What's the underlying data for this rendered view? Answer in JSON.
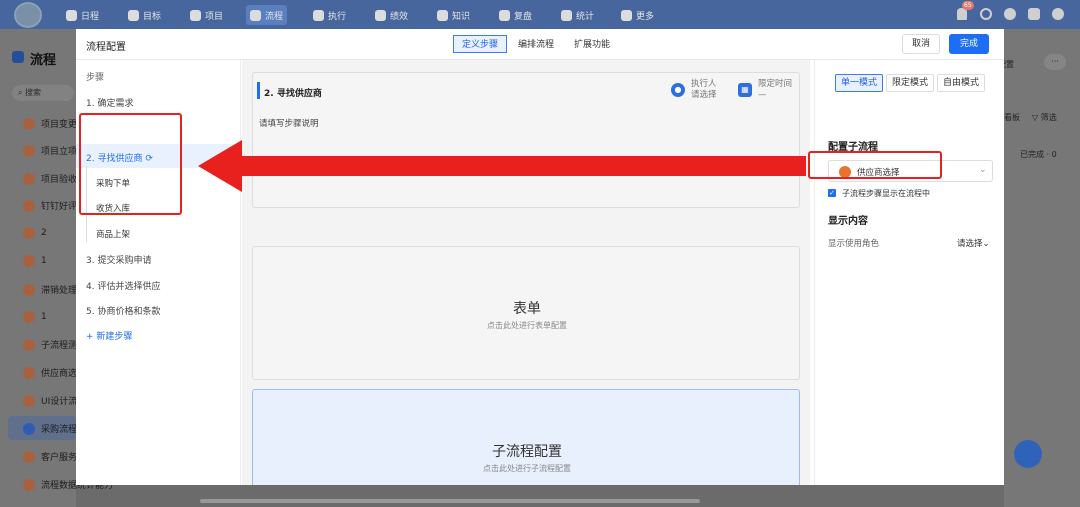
{
  "topnav": {
    "items": [
      "日程",
      "目标",
      "项目",
      "流程",
      "执行",
      "绩效",
      "知识",
      "复盘",
      "统计",
      "更多"
    ],
    "active": "流程",
    "badge": "65"
  },
  "bg": {
    "page_title": "流程",
    "search_placeholder": "搜索",
    "items": [
      "项目变更",
      "项目立项",
      "项目验收",
      "钉钉好评",
      "2",
      "1",
      "滞销处理",
      "1",
      "子流程测",
      "供应商选",
      "UI设计流",
      "采购流程",
      "客户服务",
      "流程数据统计能力"
    ],
    "right_config": "配置",
    "right_more": "···",
    "right_board": "看板",
    "right_filter": "筛选",
    "right_done": "已完成 · 0"
  },
  "modal": {
    "title": "流程配置",
    "tabs": [
      "定义步骤",
      "编排流程",
      "扩展功能"
    ],
    "active_tab": "定义步骤",
    "cancel": "取消",
    "done": "完成"
  },
  "steps": {
    "heading": "步骤",
    "items": [
      "1. 确定需求",
      "2. 寻找供应商",
      "3. 提交采购申请",
      "4. 评估并选择供应",
      "5. 协商价格和条款"
    ],
    "active_index": 1,
    "subs": [
      "采购下单",
      "收货入库",
      "商品上架"
    ],
    "new_step": "+ 新建步骤"
  },
  "main": {
    "step_title": "2. 寻找供应商",
    "step_desc": "请填写步骤说明",
    "executor_label": "执行人",
    "executor_value": "请选择",
    "time_label": "限定时间",
    "time_value": "—",
    "form_title": "表单",
    "form_hint": "点击此处进行表单配置",
    "subflow_title": "子流程配置",
    "subflow_hint": "点击此处进行子流程配置"
  },
  "right": {
    "modes": [
      "单一模式",
      "限定模式",
      "自由模式"
    ],
    "active_mode": "单一模式",
    "config_title": "配置子流程",
    "selected_flow": "供应商选择",
    "checkbox_label": "子流程步骤显示在流程中",
    "checkbox_checked": true,
    "display_title": "显示内容",
    "role_label": "显示使用角色",
    "role_value": "请选择"
  },
  "colors": {
    "accent": "#1d6ef2",
    "annotation": "#e8211f"
  }
}
